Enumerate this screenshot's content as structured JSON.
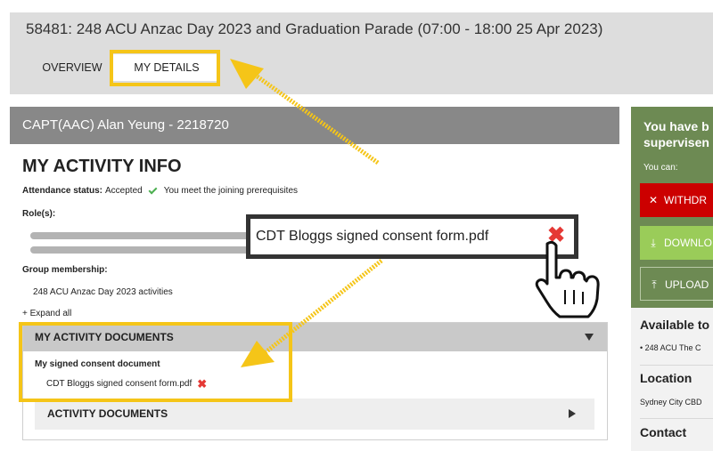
{
  "header": {
    "activity_title": "58481: 248 ACU Anzac Day 2023 and Graduation Parade (07:00 - 18:00 25 Apr 2023)",
    "tabs": [
      {
        "label": "OVERVIEW"
      },
      {
        "label": "MY DETAILS"
      }
    ]
  },
  "person": {
    "name_bar": "CAPT(AAC) Alan Yeung - 2218720"
  },
  "info": {
    "heading": "MY ACTIVITY INFO",
    "attendance_label": "Attendance status:",
    "attendance_value": "Accepted",
    "prereq_text": "You meet the joining prerequisites",
    "roles_label": "Role(s):",
    "group_label": "Group membership:",
    "group_item": "248 ACU Anzac Day 2023 activities",
    "expand_all": "+ Expand all"
  },
  "documents": {
    "header": "MY ACTIVITY DOCUMENTS",
    "consent_label": "My signed consent document",
    "consent_file": "CDT Bloggs signed consent form.pdf",
    "activity_docs_label": "ACTIVITY DOCUMENTS"
  },
  "callout": {
    "file_name": "CDT Bloggs signed consent form.pdf"
  },
  "side_panel": {
    "title_line1": "You have b",
    "title_line2": "supervisen",
    "you_can": "You can:",
    "withdraw_label": "WITHDR",
    "download_label": "DOWNLO",
    "upload_label": "UPLOAD"
  },
  "aside": {
    "available_heading": "Available to",
    "available_item": "• 248 ACU The C",
    "location_heading": "Location",
    "location_value": "Sydney City CBD",
    "contact_heading": "Contact"
  },
  "colors": {
    "annotation_yellow": "#f5c518",
    "delete_red": "#e53935",
    "withdraw_red": "#cc0000",
    "download_green": "#9acc59",
    "side_panel_green": "#6d8a53"
  },
  "icons": {
    "attendance": "check-icon",
    "delete": "close-icon",
    "collapse": "triangle-down-icon",
    "expand": "triangle-right-icon",
    "withdraw": "x-icon",
    "download": "download-icon",
    "upload": "upload-icon",
    "pointer": "hand-cursor-icon"
  }
}
